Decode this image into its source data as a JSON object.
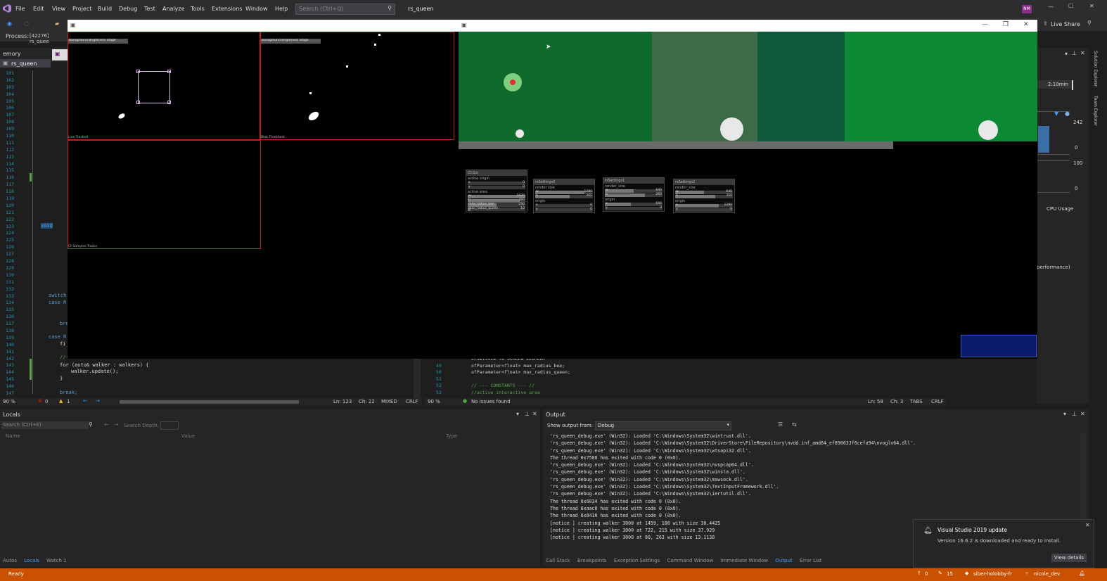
{
  "titlebar": {
    "menus": [
      "File",
      "Edit",
      "View",
      "Project",
      "Build",
      "Debug",
      "Test",
      "Analyze",
      "Tools",
      "Extensions",
      "Window",
      "Help"
    ],
    "search_placeholder": "Search (Ctrl+Q)",
    "solution_name": "rs_queen",
    "avatar_initials": "NM",
    "live_share": "Live Share"
  },
  "toolbar": {
    "process_label": "Process:",
    "process_value": "[42276] rs_quee"
  },
  "left_panel": {
    "tab_label": "emory",
    "project_item": "rs_queen",
    "line_numbers": [
      "101",
      "102",
      "103",
      "104",
      "105",
      "106",
      "107",
      "108",
      "109",
      "110",
      "111",
      "112",
      "113",
      "114",
      "115",
      "116",
      "117",
      "118",
      "119",
      "120",
      "121",
      "122",
      "123",
      "124",
      "125",
      "126",
      "127",
      "128",
      "129",
      "130",
      "131",
      "132",
      "133",
      "134",
      "135",
      "136",
      "137",
      "138",
      "139",
      "140",
      "141",
      "142",
      "143",
      "144",
      "145",
      "146",
      "147"
    ],
    "code_fragments": {
      "void": "void",
      "switch": "switch",
      "case1": "case R",
      "brk1": "bre",
      "case2": "case R",
      "fi": "fi",
      "comment": "//--- TRACKS",
      "for_line": "for (auto& walker : walkers) {",
      "update_line": "walker.update();",
      "brace": "}",
      "break_line": "break;"
    }
  },
  "editor_left_status": {
    "zoom": "90 %",
    "errors": "0",
    "warnings": "1",
    "ln": "Ln: 123",
    "ch": "Ch: 22",
    "mixed": "MIXED",
    "crlf": "CRLF"
  },
  "editor_right": {
    "lines": [
      {
        "num": "",
        "text": "ofSetSize TO SCREEN ELEMENT"
      },
      {
        "num": "49",
        "text": "ofParameter<float> max_radius_bee;"
      },
      {
        "num": "50",
        "text": "ofParameter<float> max_radius_queen;"
      },
      {
        "num": "51",
        "text": ""
      },
      {
        "num": "52",
        "text": "// --- CONSTANTS --- //"
      },
      {
        "num": "53",
        "text": "//active interactive area"
      }
    ],
    "status": {
      "zoom": "90 %",
      "issues": "No issues found",
      "ln": "Ln: 58",
      "ch": "Ch: 3",
      "tabs": "TABS",
      "crlf": "CRLF"
    }
  },
  "right_diag": {
    "timer": "2:10min",
    "v242": "242",
    "v0a": "0",
    "v100": "100",
    "v0b": "0",
    "cpu_usage": "CPU Usage",
    "perf": "performance)",
    "side_tabs": [
      "Solution Explorer",
      "Team Explorer"
    ]
  },
  "locals": {
    "title": "Locals",
    "search_placeholder": "Search (Ctrl+E)",
    "search_depth": "Search Depth:",
    "cols": [
      "Name",
      "Value",
      "Type"
    ],
    "tabs": [
      "Autos",
      "Locals",
      "Watch 1"
    ]
  },
  "output": {
    "title": "Output",
    "show_from": "Show output from:",
    "source": "Debug",
    "lines": [
      "'rs_queen_debug.exe' (Win32): Loaded 'C:\\Windows\\System32\\wintrust.dll'.",
      "'rs_queen_debug.exe' (Win32): Loaded 'C:\\Windows\\System32\\DriverStore\\FileRepository\\nvdd.inf_amd64_ef89063Jf6cefa94\\nvoglv64.dll'.",
      "'rs_queen_debug.exe' (Win32): Loaded 'C:\\Windows\\System32\\wtsapi32.dll'.",
      "The thread 0x7500 has exited with code 0 (0x0).",
      "'rs_queen_debug.exe' (Win32): Loaded 'C:\\Windows\\System32\\nvspcap64.dll'.",
      "'rs_queen_debug.exe' (Win32): Loaded 'C:\\Windows\\System32\\winsta.dll'.",
      "'rs_queen_debug.exe' (Win32): Loaded 'C:\\Windows\\System32\\mswsock.dll'.",
      "'rs_queen_debug.exe' (Win32): Loaded 'C:\\Windows\\System32\\TextInputFramework.dll'.",
      "'rs_queen_debug.exe' (Win32): Loaded 'C:\\Windows\\System32\\iertutil.dll'.",
      "The thread 0x6034 has exited with code 0 (0x0).",
      "The thread 0xaac0 has exited with code 0 (0x0).",
      "The thread 0x8410 has exited with code 0 (0x0).",
      "[notice ] creating walker 3000 at 1459, 100 with size 30.4425",
      "[notice ] creating walker 3000 at 722, 215 with size 37.929",
      "[notice ] creating walker 3000 at 80, 263 with size 13.1138"
    ],
    "tabs": [
      "Call Stack",
      "Breakpoints",
      "Exception Settings",
      "Command Window",
      "Immediate Window",
      "Output",
      "Error List"
    ]
  },
  "toast": {
    "title": "Visual Studio 2019 update",
    "body": "Version 16.6.2 is downloaded and ready to install.",
    "button": "View details"
  },
  "status": {
    "ready": "Ready",
    "up": "0",
    "edits": "15",
    "repo": "siber-holobby-fr",
    "branch": "nicole_dev"
  },
  "app_left": {
    "panel_labels": [
      "Background Brightness Stage",
      "Background Brightness Stage",
      "Live Tracked",
      "Blob Threshold",
      "Ct Samples Tracks"
    ],
    "pixel_values": {
      "sel_x": "",
      "sel_y": ""
    }
  },
  "app_right": {
    "panels": [
      {
        "title": "Cf.Gui",
        "rows": [
          {
            "type": "label",
            "text": "active origin"
          },
          {
            "type": "bar",
            "text": "x",
            "value": "0",
            "fill": 0
          },
          {
            "type": "bar",
            "text": "y",
            "value": "0",
            "fill": 0
          },
          {
            "type": "label",
            "text": "active area"
          },
          {
            "type": "bar",
            "text": "w",
            "value": "1920",
            "fill": 1
          },
          {
            "type": "bar",
            "text": "h",
            "value": "350",
            "fill": 0.9
          },
          {
            "type": "bar",
            "text": "max_radius_bee",
            "value": "250",
            "fill": 0.5
          },
          {
            "type": "bar",
            "text": "max_radius_queen",
            "value": "10",
            "fill": 0.05
          }
        ]
      },
      {
        "title": "rsSettings0",
        "rows": [
          {
            "type": "label",
            "text": "render size"
          },
          {
            "type": "bar",
            "text": "w",
            "value": "1280",
            "fill": 0.85
          },
          {
            "type": "bar",
            "text": "h",
            "value": "265",
            "fill": 0.6
          },
          {
            "type": "label",
            "text": "origin"
          },
          {
            "type": "bar",
            "text": "x",
            "value": "0",
            "fill": 0
          },
          {
            "type": "bar",
            "text": "y",
            "value": "0",
            "fill": 0
          }
        ]
      },
      {
        "title": "rsSettings1",
        "rows": [
          {
            "type": "label",
            "text": "render_size"
          },
          {
            "type": "bar",
            "text": "w",
            "value": "640",
            "fill": 0.5
          },
          {
            "type": "bar",
            "text": "h",
            "value": "260",
            "fill": 0.7
          },
          {
            "type": "label",
            "text": "origin"
          },
          {
            "type": "bar",
            "text": "x",
            "value": "640",
            "fill": 0.45
          },
          {
            "type": "bar",
            "text": "y",
            "value": "0",
            "fill": 0
          }
        ]
      },
      {
        "title": "rsSettings2",
        "rows": [
          {
            "type": "label",
            "text": "render_size"
          },
          {
            "type": "bar",
            "text": "w",
            "value": "640",
            "fill": 0.5
          },
          {
            "type": "bar",
            "text": "h",
            "value": "350",
            "fill": 0.7
          },
          {
            "type": "label",
            "text": "origin"
          },
          {
            "type": "bar",
            "text": "x",
            "value": "1280",
            "fill": 0.75
          },
          {
            "type": "bar",
            "text": "y",
            "value": "0",
            "fill": 0
          }
        ]
      }
    ],
    "bands": [
      "#0f6b2b",
      "#3d6b47",
      "#0f5a3b",
      "#0c8a33"
    ]
  }
}
